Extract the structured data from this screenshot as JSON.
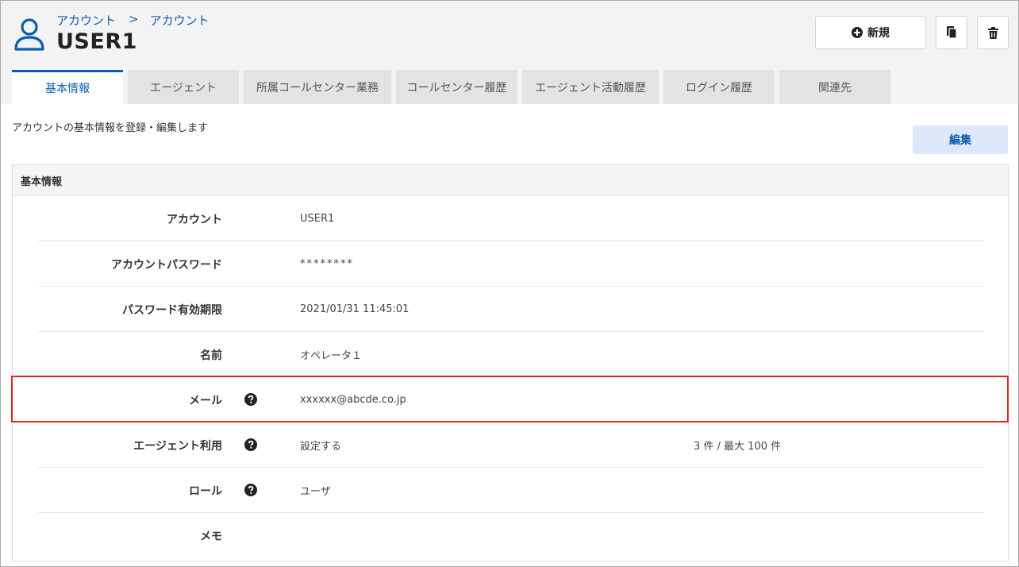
{
  "header": {
    "breadcrumb": [
      "アカウント",
      "アカウント"
    ],
    "breadcrumb_separator": ">",
    "title": "USER1",
    "new_button_label": "新規",
    "icons": {
      "user": "user-icon",
      "new": "plus-circle-icon",
      "copy": "copy-icon",
      "delete": "trash-icon"
    }
  },
  "tabs": [
    {
      "label": "基本情報",
      "active": true
    },
    {
      "label": "エージェント",
      "active": false
    },
    {
      "label": "所属コールセンター業務",
      "active": false
    },
    {
      "label": "コールセンター履歴",
      "active": false
    },
    {
      "label": "エージェント活動履歴",
      "active": false
    },
    {
      "label": "ログイン履歴",
      "active": false
    },
    {
      "label": "関連先",
      "active": false
    }
  ],
  "content": {
    "description": "アカウントの基本情報を登録・編集します",
    "edit_button_label": "編集",
    "panel_title": "基本情報"
  },
  "fields": [
    {
      "label": "アカウント",
      "value": "USER1",
      "help": false
    },
    {
      "label": "アカウントパスワード",
      "value": "********",
      "help": false
    },
    {
      "label": "パスワード有効期限",
      "value": "2021/01/31 11:45:01",
      "help": false
    },
    {
      "label": "名前",
      "value": "オペレータ１",
      "help": false
    },
    {
      "label": "メール",
      "value": "xxxxxx@abcde.co.jp",
      "help": true
    },
    {
      "label": "エージェント利用",
      "value": "設定する",
      "value2": "3 件 / 最大 100 件",
      "help": true
    },
    {
      "label": "ロール",
      "value": "ユーザ",
      "help": true
    },
    {
      "label": "メモ",
      "value": "",
      "help": false
    }
  ],
  "colors": {
    "accent": "#0b5cad",
    "highlight": "#e02424",
    "edit_button_bg": "#dde8fb"
  }
}
